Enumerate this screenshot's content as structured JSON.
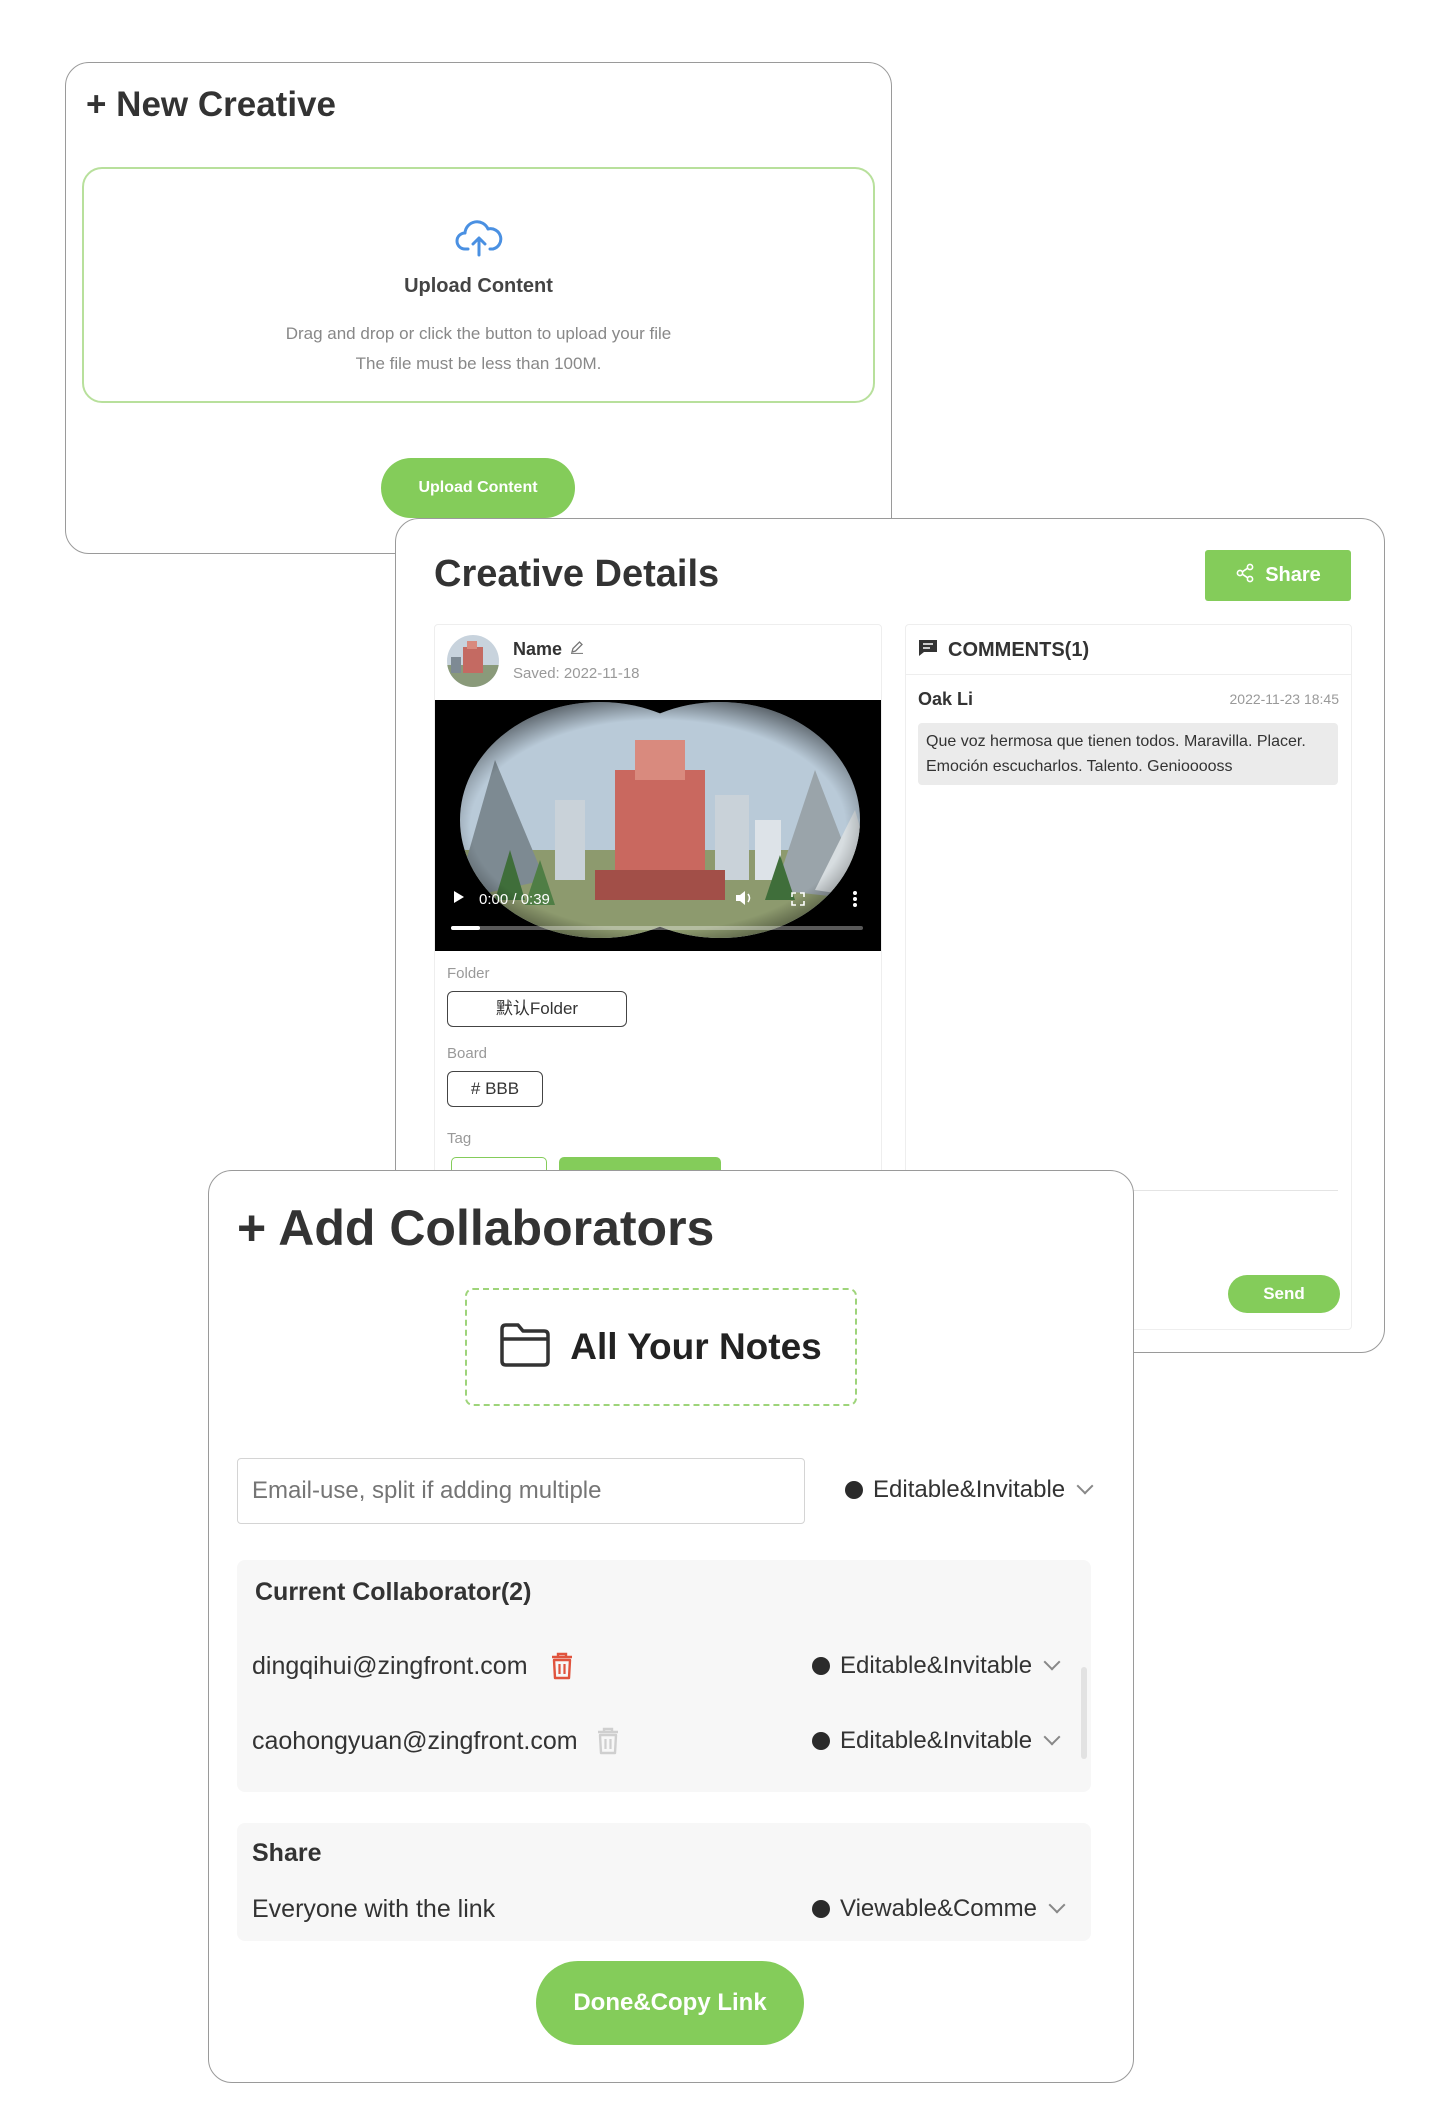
{
  "new_creative": {
    "title": "+ New Creative",
    "upload_area": {
      "icon": "cloud-upload-icon",
      "title": "Upload Content",
      "hint_line1": "Drag and drop or click the button to upload your file",
      "hint_line2": "The file must be less than 100M."
    },
    "upload_button": "Upload Content"
  },
  "creative_details": {
    "title": "Creative Details",
    "share_button": "Share",
    "item": {
      "name": "Name",
      "saved_label": "Saved",
      "saved_date": "2022-11-18"
    },
    "video": {
      "time": "0:00 / 0:39"
    },
    "folder_label": "Folder",
    "folder_value": "默认Folder",
    "board_label": "Board",
    "board_value": "# BBB",
    "tag_label": "Tag",
    "comments": {
      "header": "COMMENTS(1)",
      "items": [
        {
          "author": "Oak Li",
          "time": "2022-11-23 18:45",
          "text": "Que voz hermosa que tienen todos. Maravilla. Placer. Emoción escucharlos. Talento. Geniooooss"
        }
      ],
      "send_button": "Send"
    }
  },
  "add_collaborators": {
    "title": "+ Add Collaborators",
    "notes_label": "All Your Notes",
    "email_placeholder": "Email-use, split if adding multiple",
    "permission_default": "Editable&Invitable",
    "current_header": "Current Collaborator(2)",
    "collaborators": [
      {
        "email": "dingqihui@zingfront.com",
        "permission": "Editable&Invitable"
      },
      {
        "email": "caohongyuan@zingfront.com",
        "permission": "Editable&Invitable"
      }
    ],
    "share": {
      "header": "Share",
      "scope": "Everyone with the link",
      "permission": "Viewable&Comme"
    },
    "done_button": "Done&Copy Link"
  },
  "colors": {
    "accent": "#84cc5a",
    "danger": "#e0533d",
    "border": "#9a9a9a"
  }
}
